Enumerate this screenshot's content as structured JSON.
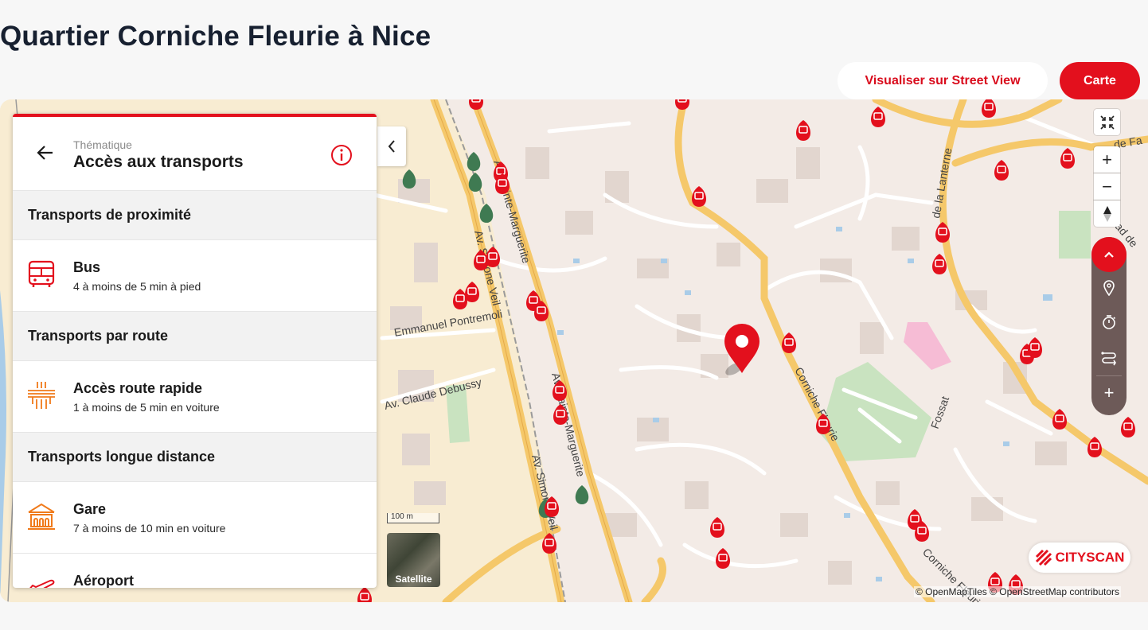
{
  "page": {
    "title": "Quartier Corniche Fleurie à Nice"
  },
  "actions": {
    "street_view": "Visualiser sur Street View",
    "map_mode": "Carte"
  },
  "panel": {
    "theme_label": "Thématique",
    "theme_title": "Accès aux transports",
    "sections": [
      {
        "title": "Transports de proximité",
        "items": [
          {
            "icon": "bus-icon",
            "title": "Bus",
            "subtitle": "4 à moins de 5 min à pied"
          }
        ]
      },
      {
        "title": "Transports par route",
        "items": [
          {
            "icon": "highway-icon",
            "title": "Accès route rapide",
            "subtitle": "1 à moins de 5 min en voiture"
          }
        ]
      },
      {
        "title": "Transports longue distance",
        "items": [
          {
            "icon": "train-station-icon",
            "title": "Gare",
            "subtitle": "7 à moins de 10 min en voiture"
          },
          {
            "icon": "airplane-icon",
            "title": "Aéroport",
            "subtitle": ""
          }
        ]
      }
    ]
  },
  "map": {
    "street_labels": [
      "Av. Sainte-Marguerite",
      "Av. Sainte-Marguerite",
      "Av. Simone Veil",
      "Av. Simone Veil",
      "Emmanuel Pontremoli",
      "Av. Claude Debussy",
      "Corniche Fleurie",
      "Corniche Fleurie",
      "Fossat",
      "de la Lanterne",
      "de Fa",
      "ad de"
    ],
    "scale_label": "100 m",
    "satellite_label": "Satellite",
    "attribution": "© OpenMapTiles © OpenStreetMap contributors",
    "brand": "CITYSCAN",
    "colors": {
      "accent": "#e3101d",
      "bus_marker": "#e3101d",
      "green_marker": "#3f7a52",
      "road": "#f5c86a",
      "background": "#f3ebe6"
    }
  }
}
